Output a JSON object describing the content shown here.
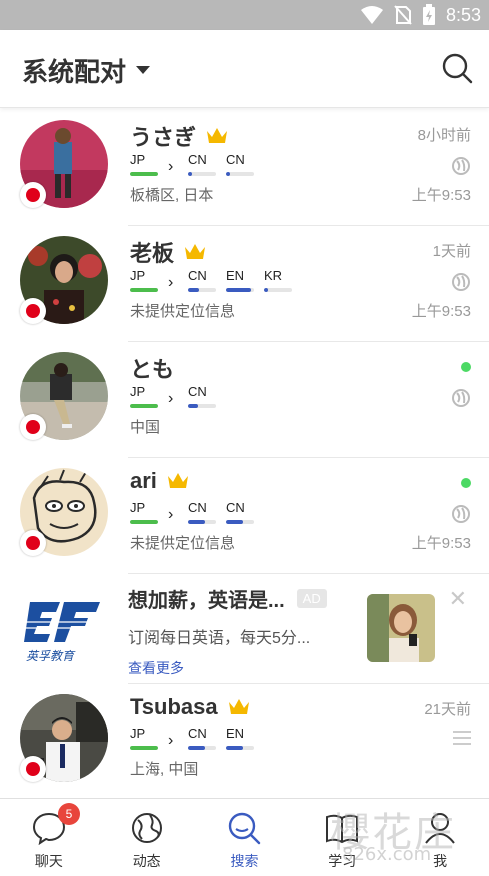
{
  "status_bar": {
    "time": "8:53"
  },
  "header": {
    "title": "系统配对"
  },
  "users": [
    {
      "name": "うさぎ",
      "crown": true,
      "langs": [
        {
          "code": "JP",
          "level": 1.0,
          "color": "#4cbd4c"
        },
        {
          "code": "CN",
          "level": 0.15,
          "color": "#3a5bc0"
        },
        {
          "code": "CN",
          "level": 0.15,
          "color": "#3a5bc0"
        }
      ],
      "location": "板橋区, 日本",
      "time_top": "8小时前",
      "time_bottom": "上午9:53",
      "status": "globe"
    },
    {
      "name": "老板",
      "crown": true,
      "langs": [
        {
          "code": "JP",
          "level": 1.0,
          "color": "#4cbd4c"
        },
        {
          "code": "CN",
          "level": 0.4,
          "color": "#3a5bc0"
        },
        {
          "code": "EN",
          "level": 0.9,
          "color": "#3a5bc0"
        },
        {
          "code": "KR",
          "level": 0.15,
          "color": "#3a5bc0"
        }
      ],
      "location": "未提供定位信息",
      "time_top": "1天前",
      "time_bottom": "上午9:53",
      "status": "globe"
    },
    {
      "name": "とも",
      "crown": false,
      "langs": [
        {
          "code": "JP",
          "level": 1.0,
          "color": "#4cbd4c"
        },
        {
          "code": "CN",
          "level": 0.35,
          "color": "#3a5bc0"
        }
      ],
      "location": "中国",
      "time_top": "",
      "time_bottom": "",
      "status": "online"
    },
    {
      "name": "ari",
      "crown": true,
      "langs": [
        {
          "code": "JP",
          "level": 1.0,
          "color": "#4cbd4c"
        },
        {
          "code": "CN",
          "level": 0.6,
          "color": "#3a5bc0"
        },
        {
          "code": "CN",
          "level": 0.6,
          "color": "#3a5bc0"
        }
      ],
      "location": "未提供定位信息",
      "time_top": "",
      "time_bottom": "上午9:53",
      "status": "online"
    }
  ],
  "ad": {
    "title": "想加薪，英语是...",
    "badge": "AD",
    "desc": "订阅每日英语，每天5分...",
    "more": "查看更多",
    "logo_text": "英孚教育",
    "close": "✕"
  },
  "last_user": {
    "name": "Tsubasa",
    "crown": true,
    "langs": [
      {
        "code": "JP",
        "level": 1.0,
        "color": "#4cbd4c"
      },
      {
        "code": "CN",
        "level": 0.6,
        "color": "#3a5bc0"
      },
      {
        "code": "EN",
        "level": 0.6,
        "color": "#3a5bc0"
      }
    ],
    "location": "上海, 中国",
    "time_top": "21天前"
  },
  "tabs": [
    {
      "label": "聊天",
      "icon": "chat-icon",
      "badge": "5"
    },
    {
      "label": "动态",
      "icon": "globe-icon"
    },
    {
      "label": "搜索",
      "icon": "search-icon",
      "active": true
    },
    {
      "label": "学习",
      "icon": "book-icon"
    },
    {
      "label": "我",
      "icon": "profile-icon"
    }
  ],
  "watermark": {
    "main": "櫻花庄",
    "sub": "826x.com"
  },
  "colors": {
    "accent": "#3a5bc0",
    "native": "#4cbd4c",
    "online": "#4cd964",
    "crown": "#f5b800",
    "flag": "#e0001a"
  }
}
